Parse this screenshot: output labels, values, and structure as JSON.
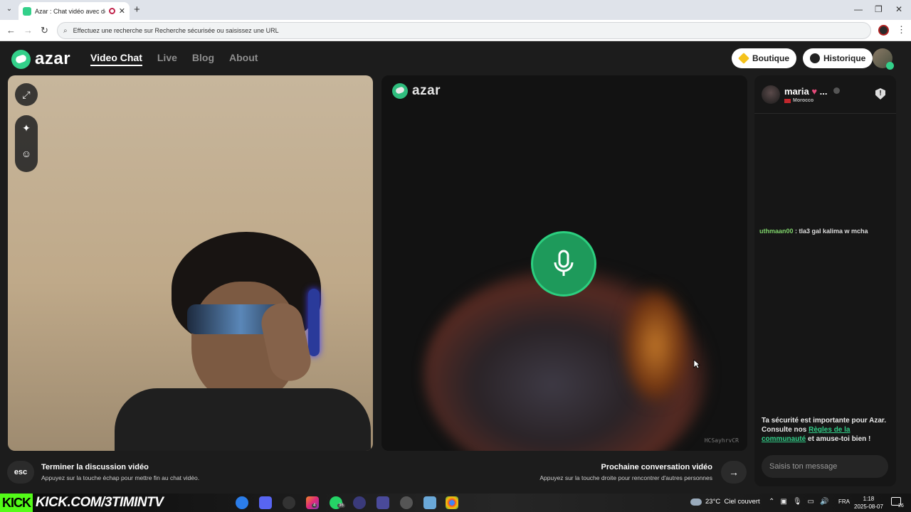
{
  "browser": {
    "tab_title": "Azar : Chat vidéo avec de n",
    "new_tab": "+",
    "address_placeholder": "Effectuez une recherche sur Recherche sécurisée ou saisissez une URL"
  },
  "header": {
    "logo": "azar",
    "nav": [
      "Video Chat",
      "Live",
      "Blog",
      "About"
    ],
    "boutique_label": "Boutique",
    "historique_label": "Historique"
  },
  "right_video": {
    "logo": "azar",
    "watermark": "HCSayhrvCR"
  },
  "chat": {
    "partner_name": "maria",
    "partner_name_suffix": "...",
    "partner_country": "Morocco",
    "messages": [
      {
        "user": "uthmaan00",
        "text": " : tla3 gal kalima w mcha"
      }
    ],
    "safety_text_1": "Ta sécurité est importante pour Azar. Consulte nos ",
    "safety_link": "Règles de la communauté",
    "safety_text_2": " et amuse-toi bien !",
    "input_placeholder": "Saisis ton message"
  },
  "controls": {
    "esc_key": "esc",
    "end_title": "Terminer la discussion vidéo",
    "end_subtitle": "Appuyez sur la touche échap pour mettre fin au chat vidéo.",
    "next_title": "Prochaine conversation vidéo",
    "next_subtitle": "Appuyez sur la touche droite pour rencontrer d'autres personnes"
  },
  "taskbar": {
    "kick_logo": "KICK",
    "kick_url": "KICK.COM/3TIMINTV",
    "badge_instagram": "4",
    "badge_whatsapp": "36",
    "temperature": "23°C",
    "weather": "Ciel couvert",
    "language": "FRA",
    "time": "1:18",
    "date": "2025-08-07",
    "notifications": "26"
  },
  "colors": {
    "brand": "#33d08a",
    "mic_bg": "#1e9a5b",
    "username": "#7fd36b"
  }
}
